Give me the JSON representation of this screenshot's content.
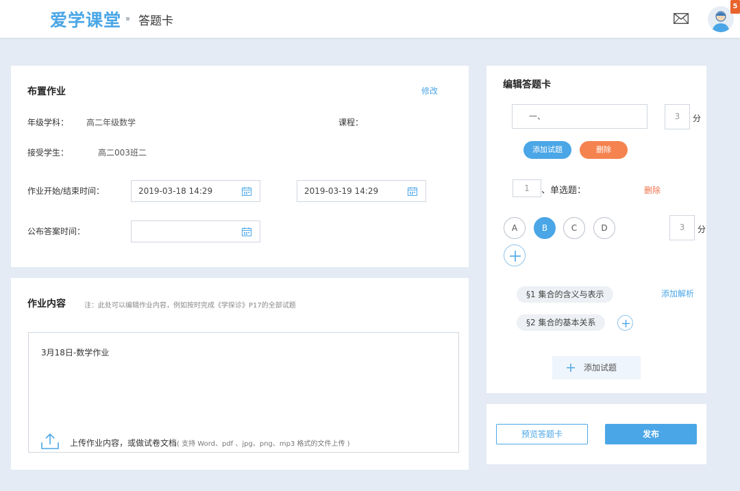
{
  "header": {
    "logo": "爱学课堂",
    "page_title": "答题卡",
    "corner_badge": "5"
  },
  "assign_panel": {
    "title": "布置作业",
    "edit_link": "修改",
    "grade_subject_label": "年级学科：",
    "grade_subject_value": "高二年级数学",
    "course_label": "课程：",
    "course_value": "",
    "students_label": "接受学生：",
    "students_value": "高二003班二",
    "time_label": "作业开始/结束时间：",
    "start_time": "2019-03-18 14:29",
    "end_time": "2019-03-19 14:29",
    "answer_time_label": "公布答案时间：",
    "answer_time": ""
  },
  "content_panel": {
    "title": "作业内容",
    "note": "注：此处可以编辑作业内容，例如按时完成《学探诊》P17的全部试题",
    "text": "3月18日-数学作业",
    "upload_text": "上传作业内容，或做试卷文档",
    "upload_hint": "( 支持 Word、pdf 、jpg、png、mp3 格式的文件上传 )"
  },
  "card_panel": {
    "title": "编辑答题卡",
    "section_name": "一、",
    "section_score": "3",
    "score_unit": "分",
    "add_question_btn": "添加试题",
    "delete_btn": "删除",
    "question_no": "1",
    "question_type": "、单选题：",
    "question_delete": "删除",
    "options": [
      {
        "label": "A",
        "selected": false
      },
      {
        "label": "B",
        "selected": true
      },
      {
        "label": "C",
        "selected": false
      },
      {
        "label": "D",
        "selected": false
      }
    ],
    "question_score": "3",
    "add_analysis": "添加解析",
    "tags": [
      "§1 集合的含义与表示",
      "§2 集合的基本关系"
    ],
    "add_question_bottom": "添加试题"
  },
  "actions": {
    "preview": "预览答题卡",
    "publish": "发布"
  },
  "colors": {
    "accent": "#4aa6e6",
    "danger": "#f5834f",
    "background": "#e4ebf4"
  }
}
